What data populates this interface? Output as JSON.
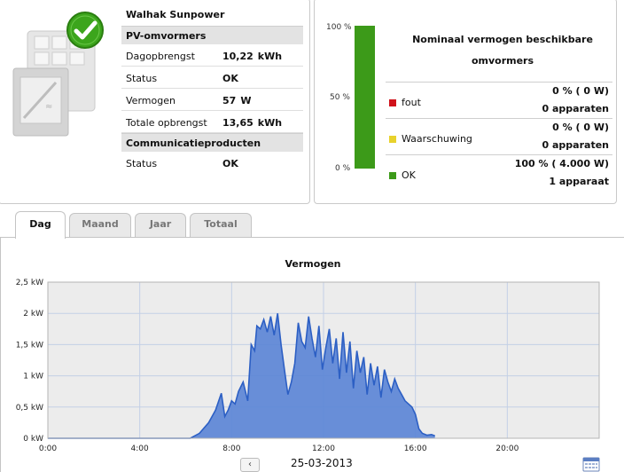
{
  "device": {
    "title": "Walhak Sunpower",
    "pv_section": "PV-omvormers",
    "rows": [
      {
        "label": "Dagopbrengst",
        "value": "10,22",
        "unit": "kWh"
      },
      {
        "label": "Status",
        "value": "OK",
        "unit": ""
      },
      {
        "label": "Vermogen",
        "value": "57",
        "unit": "W"
      },
      {
        "label": "Totale opbrengst",
        "value": "13,65",
        "unit": "kWh"
      }
    ],
    "comm_section": "Communicatieproducten",
    "comm_rows": [
      {
        "label": "Status",
        "value": "OK",
        "unit": ""
      }
    ]
  },
  "nominal": {
    "title": "Nominaal vermogen beschikbare omvormers",
    "bar_ticks": [
      "100 %",
      "50 %",
      "0 %"
    ],
    "ok_fraction": 1.0,
    "bar_color": "#3c9a19",
    "items": [
      {
        "label": "fout",
        "percent": "0 %",
        "power": "( 0 W)",
        "count": "0 apparaten",
        "color": "#d0121b"
      },
      {
        "label": "Waarschuwing",
        "percent": "0 %",
        "power": "( 0 W)",
        "count": "0 apparaten",
        "color": "#e8d22c"
      },
      {
        "label": "OK",
        "percent": "100 %",
        "power": "( 4.000 W)",
        "count": "1 apparaat",
        "color": "#3c9a19"
      }
    ]
  },
  "tabs": [
    "Dag",
    "Maand",
    "Jaar",
    "Totaal"
  ],
  "active_tab": "Dag",
  "date": "25-03-2013",
  "prev_label": "‹",
  "chart_data": {
    "type": "area",
    "title": "Vermogen",
    "xlabel": "",
    "ylabel": "",
    "x_ticks": [
      "0:00",
      "4:00",
      "8:00",
      "12:00",
      "16:00",
      "20:00"
    ],
    "y_ticks": [
      "0 kW",
      "0,5 kW",
      "1 kW",
      "1,5 kW",
      "2 kW",
      "2,5 kW"
    ],
    "xlim": [
      0,
      24
    ],
    "ylim": [
      0,
      2.5
    ],
    "grid": true,
    "fill_color": "#5c85d6",
    "line_color": "#2c5fc4",
    "series": [
      {
        "x": [
          0,
          6.2,
          6.6,
          7.0,
          7.3,
          7.55,
          7.7,
          7.85,
          8.0,
          8.15,
          8.3,
          8.5,
          8.7,
          8.85,
          9.0,
          9.1,
          9.25,
          9.4,
          9.55,
          9.7,
          9.85,
          10.0,
          10.15,
          10.3,
          10.45,
          10.6,
          10.75,
          10.9,
          11.05,
          11.2,
          11.35,
          11.5,
          11.65,
          11.8,
          11.95,
          12.1,
          12.25,
          12.4,
          12.55,
          12.7,
          12.85,
          13.0,
          13.15,
          13.3,
          13.45,
          13.6,
          13.75,
          13.9,
          14.05,
          14.2,
          14.35,
          14.5,
          14.65,
          14.8,
          14.95,
          15.1,
          15.25,
          15.4,
          15.55,
          15.7,
          15.85,
          16.0,
          16.15,
          16.3,
          16.5,
          16.7,
          16.85
        ],
        "y": [
          0,
          0,
          0.08,
          0.25,
          0.45,
          0.72,
          0.35,
          0.45,
          0.6,
          0.55,
          0.75,
          0.9,
          0.6,
          1.5,
          1.4,
          1.8,
          1.75,
          1.9,
          1.7,
          1.95,
          1.65,
          2.0,
          1.5,
          1.1,
          0.7,
          0.9,
          1.2,
          1.85,
          1.55,
          1.45,
          1.95,
          1.6,
          1.3,
          1.8,
          1.1,
          1.45,
          1.75,
          1.2,
          1.6,
          0.95,
          1.7,
          1.05,
          1.55,
          0.8,
          1.4,
          1.05,
          1.3,
          0.7,
          1.2,
          0.85,
          1.15,
          0.65,
          1.1,
          0.9,
          0.75,
          0.95,
          0.8,
          0.7,
          0.6,
          0.55,
          0.5,
          0.38,
          0.15,
          0.08,
          0.05,
          0.06,
          0.04
        ]
      }
    ]
  }
}
